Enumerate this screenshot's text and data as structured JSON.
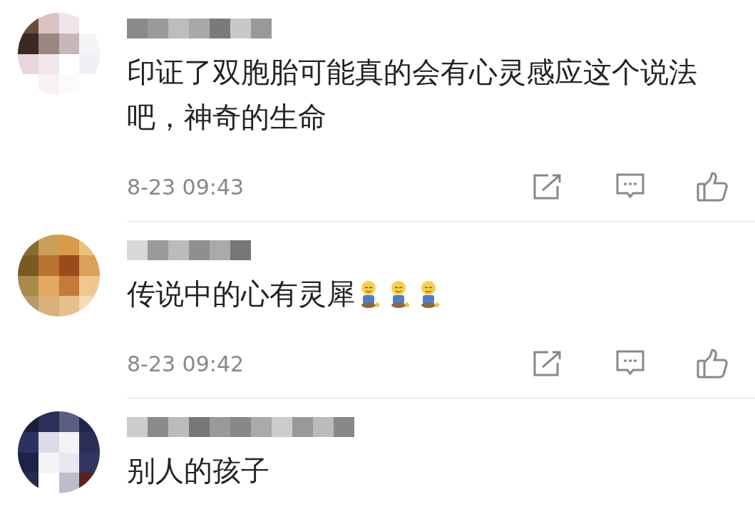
{
  "comments": [
    {
      "text": "印证了双胞胎可能真的会有心灵感应这个说法吧，神奇的生命",
      "time": "8-23 09:43"
    },
    {
      "text": "传说中的心有灵犀",
      "emojis": [
        {
          "kind": "smile"
        },
        {
          "kind": "smile"
        },
        {
          "kind": "smile"
        }
      ],
      "time": "8-23 09:42"
    },
    {
      "text": "别人的孩子"
    }
  ]
}
